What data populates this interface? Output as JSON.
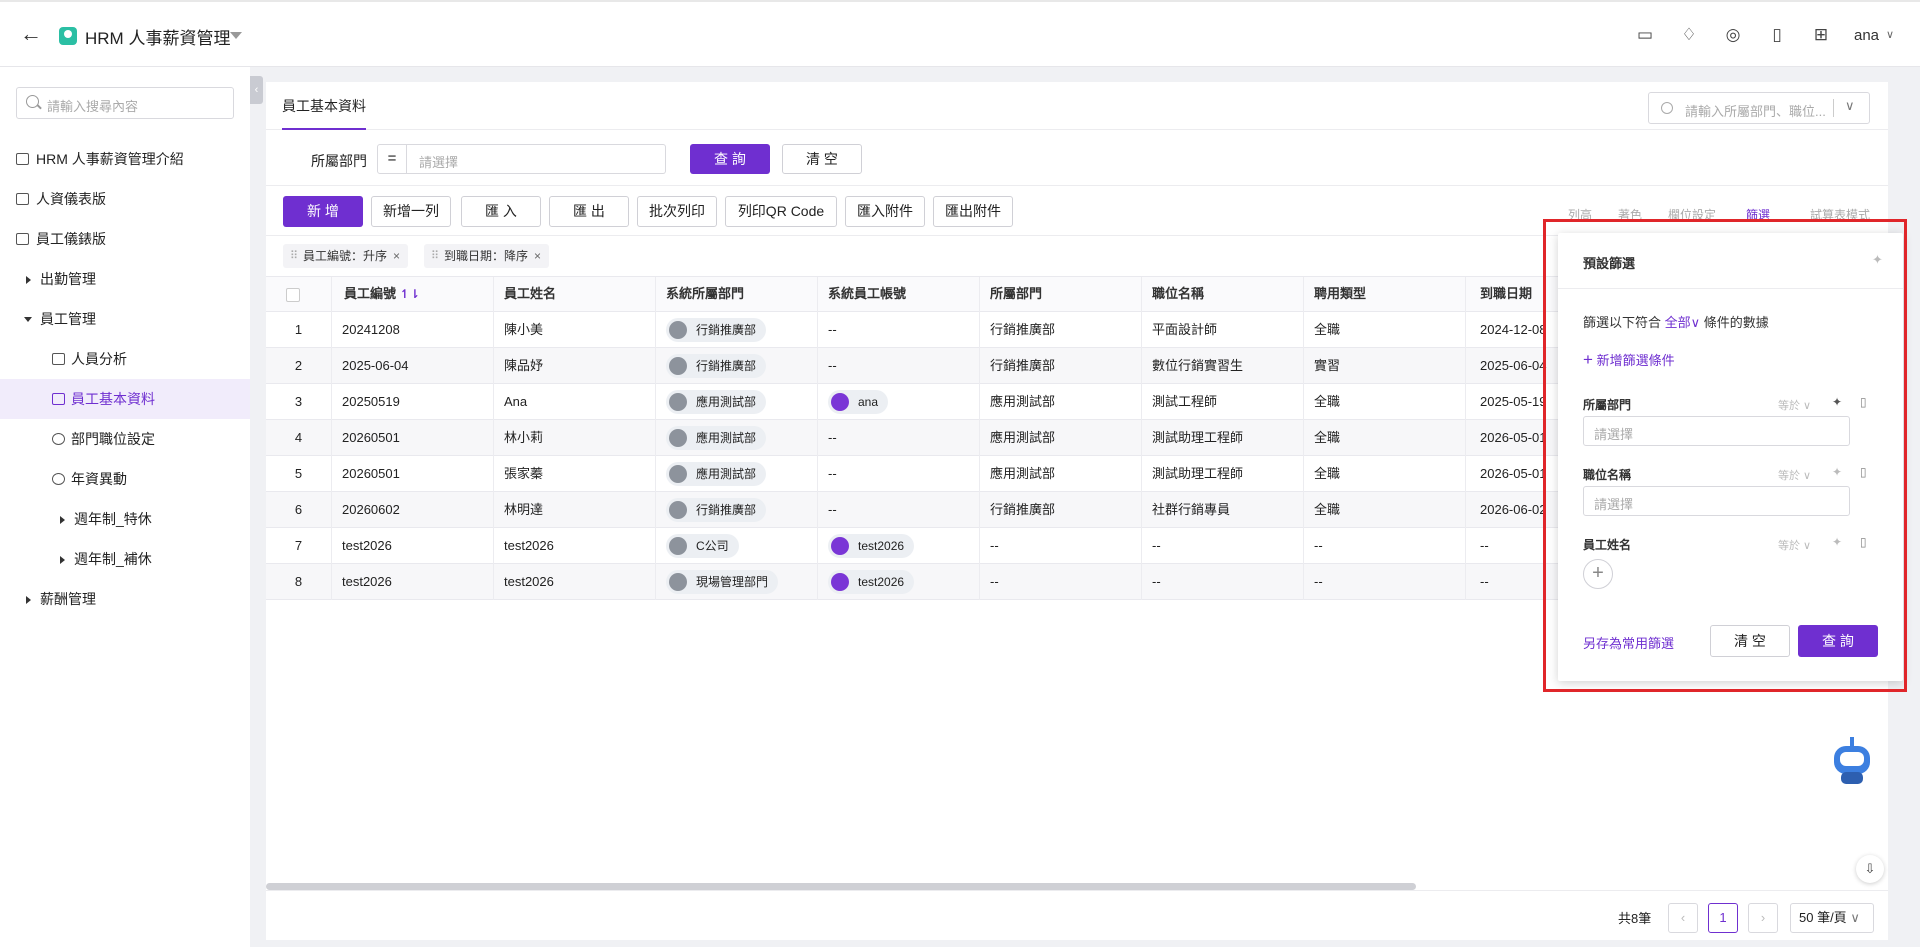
{
  "app": {
    "title": "HRM 人事薪資管理",
    "user": "ana"
  },
  "sidebar": {
    "search_placeholder": "請輸入搜尋內容",
    "items": [
      {
        "label": "HRM 人事薪資管理介紹"
      },
      {
        "label": "人資儀表版"
      },
      {
        "label": "員工儀錶版"
      },
      {
        "label": "出勤管理"
      },
      {
        "label": "員工管理"
      },
      {
        "label": "人員分析"
      },
      {
        "label": "員工基本資料"
      },
      {
        "label": "部門職位設定"
      },
      {
        "label": "年資異動"
      },
      {
        "label": "週年制_特休"
      },
      {
        "label": "週年制_補休"
      },
      {
        "label": "薪酬管理"
      }
    ]
  },
  "main": {
    "tab": "員工基本資料",
    "search_placeholder": "請輸入所屬部門、職位...",
    "filter": {
      "label": "所屬部門",
      "op": "=",
      "placeholder": "請選擇",
      "query": "查 詢",
      "clear": "清 空"
    },
    "toolbar": {
      "add": "新 增",
      "add_row": "新增一列",
      "import": "匯 入",
      "export": "匯 出",
      "batch_print": "批次列印",
      "print_qr": "列印QR Code",
      "import_attach": "匯入附件",
      "export_attach": "匯出附件",
      "right": [
        "列高",
        "著色",
        "欄位設定",
        "篩選",
        "試算表模式"
      ]
    },
    "chips": [
      "員工編號：升序",
      "到職日期：降序"
    ],
    "columns": [
      "員工編號",
      "員工姓名",
      "系統所屬部門",
      "系統員工帳號",
      "所屬部門",
      "職位名稱",
      "聘用類型",
      "到職日期"
    ],
    "rows": [
      [
        "1",
        "20241208",
        "陳小美",
        "行銷推廣部",
        "--",
        "行銷推廣部",
        "平面設計師",
        "全職",
        "2024-12-08"
      ],
      [
        "2",
        "2025-06-04",
        "陳品妤",
        "行銷推廣部",
        "--",
        "行銷推廣部",
        "數位行銷實習生",
        "實習",
        "2025-06-04"
      ],
      [
        "3",
        "20250519",
        "Ana",
        "應用測試部",
        "ana",
        "應用測試部",
        "測試工程師",
        "全職",
        "2025-05-19"
      ],
      [
        "4",
        "20260501",
        "林小莉",
        "應用測試部",
        "--",
        "應用測試部",
        "測試助理工程師",
        "全職",
        "2026-05-01"
      ],
      [
        "5",
        "20260501",
        "張家蓁",
        "應用測試部",
        "--",
        "應用測試部",
        "測試助理工程師",
        "全職",
        "2026-05-01"
      ],
      [
        "6",
        "20260602",
        "林明達",
        "行銷推廣部",
        "--",
        "行銷推廣部",
        "社群行銷專員",
        "全職",
        "2026-06-02"
      ],
      [
        "7",
        "test2026",
        "test2026",
        "C公司",
        "test2026",
        "--",
        "--",
        "--",
        "--"
      ],
      [
        "8",
        "test2026",
        "test2026",
        "現場管理部門",
        "test2026",
        "--",
        "--",
        "--",
        "--"
      ]
    ],
    "pager": {
      "total": "共8筆",
      "page": "1",
      "size": "50 筆/頁"
    }
  },
  "filter_panel": {
    "title": "預設篩選",
    "desc_pre": "篩選以下符合",
    "desc_mode": "全部",
    "desc_post": "條件的數據",
    "add_condition": "新增篩選條件",
    "fields": [
      {
        "label": "所屬部門",
        "op": "等於",
        "placeholder": "請選擇"
      },
      {
        "label": "職位名稱",
        "op": "等於",
        "placeholder": "請選擇"
      },
      {
        "label": "員工姓名",
        "op": "等於"
      }
    ],
    "save_link": "另存為常用篩選",
    "clear": "清 空",
    "query": "查 詢"
  },
  "colors": {
    "accent": "#6f2fd0",
    "highlight": "#e0262a"
  }
}
